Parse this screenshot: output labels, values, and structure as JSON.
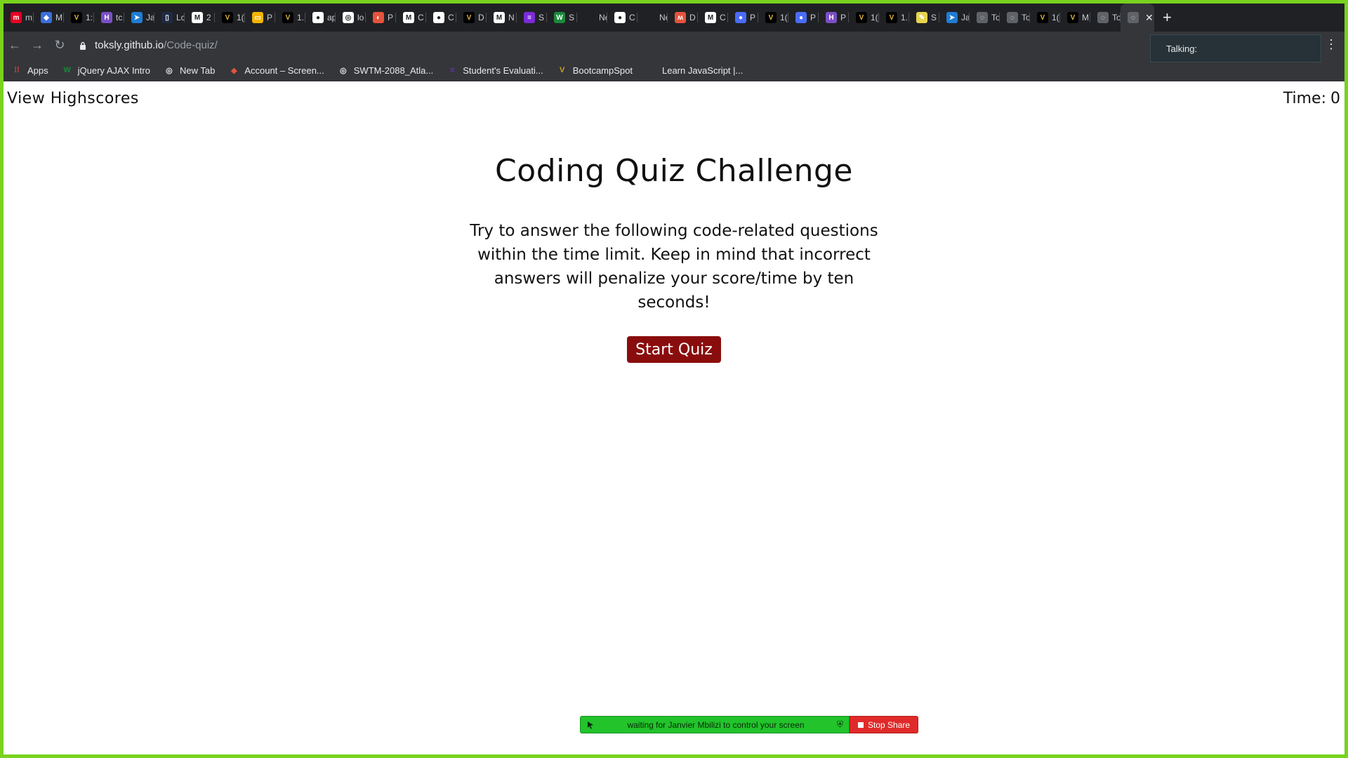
{
  "browser": {
    "tabs": [
      {
        "icon": "pinterest-icon",
        "color": "#e60023",
        "glyph": "m",
        "label": "m"
      },
      {
        "icon": "cube-icon",
        "color": "#3b6fd8",
        "glyph": "◆",
        "label": "M"
      },
      {
        "icon": "vanderbilt-icon",
        "color": "#000000",
        "glyph": "V",
        "label": "1:"
      },
      {
        "icon": "heroku-icon",
        "color": "#7b4fc5",
        "glyph": "H",
        "label": "tc"
      },
      {
        "icon": "bird-icon",
        "color": "#1f7bd4",
        "glyph": "➤",
        "label": "Ja"
      },
      {
        "icon": "doc-icon",
        "color": "#1f2a44",
        "glyph": "▯",
        "label": "Lc"
      },
      {
        "icon": "gmail-icon",
        "color": "#ffffff",
        "glyph": "M",
        "label": "2"
      },
      {
        "icon": "vanderbilt-icon",
        "color": "#000000",
        "glyph": "V",
        "label": "1("
      },
      {
        "icon": "slides-icon",
        "color": "#f4b400",
        "glyph": "▭",
        "label": "P"
      },
      {
        "icon": "vanderbilt-icon",
        "color": "#000000",
        "glyph": "V",
        "label": "1."
      },
      {
        "icon": "github-icon",
        "color": "#ffffff",
        "glyph": "●",
        "label": "ap"
      },
      {
        "icon": "globe-icon",
        "color": "#ffffff",
        "glyph": "◎",
        "label": "lo"
      },
      {
        "icon": "compass-icon",
        "color": "#e5533d",
        "glyph": "◐",
        "label": "P"
      },
      {
        "icon": "gmail-icon",
        "color": "#ffffff",
        "glyph": "M",
        "label": "C"
      },
      {
        "icon": "github-icon",
        "color": "#ffffff",
        "glyph": "●",
        "label": "C"
      },
      {
        "icon": "vanderbilt-icon",
        "color": "#000000",
        "glyph": "V",
        "label": "D"
      },
      {
        "icon": "gmail-icon",
        "color": "#ffffff",
        "glyph": "M",
        "label": "N"
      },
      {
        "icon": "list-icon",
        "color": "#7b2bd9",
        "glyph": "≡",
        "label": "S"
      },
      {
        "icon": "w-icon",
        "color": "#1a8a3a",
        "glyph": "W",
        "label": "S"
      },
      {
        "icon": "blank-icon",
        "color": "#202124",
        "glyph": "",
        "label": "New"
      },
      {
        "icon": "github-icon",
        "color": "#ffffff",
        "glyph": "●",
        "label": "C"
      },
      {
        "icon": "blank-icon",
        "color": "#202124",
        "glyph": "",
        "label": "New"
      },
      {
        "icon": "m-logo-icon",
        "color": "#e5533d",
        "glyph": "ʍ",
        "label": "D"
      },
      {
        "icon": "gmail-icon",
        "color": "#ffffff",
        "glyph": "M",
        "label": "C"
      },
      {
        "icon": "zoom-icon",
        "color": "#4a6cf7",
        "glyph": "●",
        "label": "P"
      },
      {
        "icon": "vanderbilt-icon",
        "color": "#000000",
        "glyph": "V",
        "label": "1("
      },
      {
        "icon": "zoom-icon",
        "color": "#4a6cf7",
        "glyph": "●",
        "label": "P"
      },
      {
        "icon": "heroku-icon",
        "color": "#7b4fc5",
        "glyph": "H",
        "label": "P"
      },
      {
        "icon": "vanderbilt-icon",
        "color": "#000000",
        "glyph": "V",
        "label": "1("
      },
      {
        "icon": "vanderbilt-icon",
        "color": "#000000",
        "glyph": "V",
        "label": "1."
      },
      {
        "icon": "sticky-icon",
        "color": "#e8d44d",
        "glyph": "✎",
        "label": "S"
      },
      {
        "icon": "bird-icon",
        "color": "#1f7bd4",
        "glyph": "➤",
        "label": "Ja"
      },
      {
        "icon": "globe-icon",
        "color": "#5f6368",
        "glyph": "◌",
        "label": "To"
      },
      {
        "icon": "globe-icon",
        "color": "#5f6368",
        "glyph": "◌",
        "label": "To"
      },
      {
        "icon": "vanderbilt-icon",
        "color": "#000000",
        "glyph": "V",
        "label": "1("
      },
      {
        "icon": "vanderbilt-icon",
        "color": "#000000",
        "glyph": "V",
        "label": "M"
      },
      {
        "icon": "globe-icon",
        "color": "#5f6368",
        "glyph": "◌",
        "label": "To"
      }
    ],
    "active_tab_icon": "globe-icon",
    "url_host": "toksly.github.io",
    "url_path": "/Code-quiz/",
    "bookmarks": [
      {
        "icon": "apps-icon",
        "color": "#e8453c",
        "glyph": "⁞⁞",
        "label": "Apps"
      },
      {
        "icon": "w-icon",
        "color": "#1a8a3a",
        "glyph": "W",
        "label": "jQuery AJAX Intro"
      },
      {
        "icon": "globe-icon",
        "color": "#e8eaed",
        "glyph": "◎",
        "label": "New Tab"
      },
      {
        "icon": "screencast-icon",
        "color": "#e5533d",
        "glyph": "◆",
        "label": "Account – Screen..."
      },
      {
        "icon": "globe-icon",
        "color": "#e8eaed",
        "glyph": "◎",
        "label": "SWTM-2088_Atla..."
      },
      {
        "icon": "list-icon",
        "color": "#7b2bd9",
        "glyph": "≡",
        "label": "Student's Evaluati..."
      },
      {
        "icon": "vanderbilt-icon",
        "color": "#c9a227",
        "glyph": "V",
        "label": "BootcampSpot"
      },
      {
        "icon": "blank-icon",
        "color": "#35363a",
        "glyph": "",
        "label": "Learn JavaScript |..."
      }
    ]
  },
  "talking_popup": "Talking:",
  "quiz": {
    "view_highscores": "View Highscores",
    "time_label": "Time:",
    "time_value": "0",
    "title": "Coding Quiz Challenge",
    "description": "Try to answer the following code-related questions within the time limit. Keep in mind that incorrect answers will penalize your score/time by ten seconds!",
    "start_button": "Start Quiz"
  },
  "screenshare": {
    "status": "waiting for Janvier Mbilizi to control your screen",
    "stop_label": "Stop Share"
  },
  "colors": {
    "start_button_bg": "#8a0d0d",
    "share_green": "#22c32b",
    "share_red": "#e02a2a",
    "window_border": "#78d21e"
  }
}
